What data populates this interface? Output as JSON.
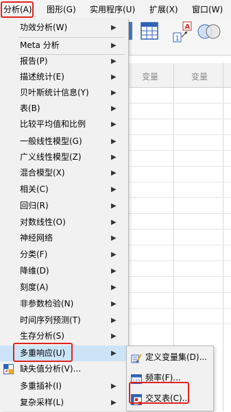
{
  "menubar": {
    "items": [
      "分析(A)",
      "图形(G)",
      "实用程序(U)",
      "扩展(X)",
      "窗口(W)"
    ]
  },
  "grid": {
    "columns": [
      "变量",
      "变量"
    ]
  },
  "analyze_menu": {
    "items": [
      {
        "label": "功效分析(W)",
        "submenu": true
      },
      {
        "label": "Meta 分析",
        "submenu": true
      },
      {
        "label": "报告(P)",
        "submenu": true
      },
      {
        "label": "描述统计(E)",
        "submenu": true
      },
      {
        "label": "贝叶斯统计信息(Y)",
        "submenu": true
      },
      {
        "label": "表(B)",
        "submenu": true
      },
      {
        "label": "比较平均值和比例",
        "submenu": true
      },
      {
        "label": "一般线性模型(G)",
        "submenu": true
      },
      {
        "label": "广义线性模型(Z)",
        "submenu": true
      },
      {
        "label": "混合模型(X)",
        "submenu": true
      },
      {
        "label": "相关(C)",
        "submenu": true
      },
      {
        "label": "回归(R)",
        "submenu": true
      },
      {
        "label": "对数线性(O)",
        "submenu": true
      },
      {
        "label": "神经网络",
        "submenu": true
      },
      {
        "label": "分类(F)",
        "submenu": true
      },
      {
        "label": "降维(D)",
        "submenu": true
      },
      {
        "label": "刻度(A)",
        "submenu": true
      },
      {
        "label": "非参数检验(N)",
        "submenu": true
      },
      {
        "label": "时间序列预测(T)",
        "submenu": true
      },
      {
        "label": "生存分析(S)",
        "submenu": true
      },
      {
        "label": "多重响应(U)",
        "submenu": true,
        "highlighted": true
      },
      {
        "label": "缺失值分析(V)...",
        "submenu": false,
        "icon": "missing-value-icon"
      },
      {
        "label": "多重插补(I)",
        "submenu": true
      },
      {
        "label": "复杂采样(L)",
        "submenu": true
      }
    ]
  },
  "multiple_response_submenu": {
    "items": [
      {
        "label": "定义变量集(D)...",
        "icon": "define-sets-icon"
      },
      {
        "label": "频率(F)...",
        "icon": "frequencies-icon"
      },
      {
        "label": "交叉表(C)...",
        "icon": "crosstabs-icon"
      }
    ]
  },
  "colors": {
    "highlight_box": "#e3211c",
    "menu_bg": "#f1f1f1",
    "hover_bg": "#cce4f7"
  }
}
